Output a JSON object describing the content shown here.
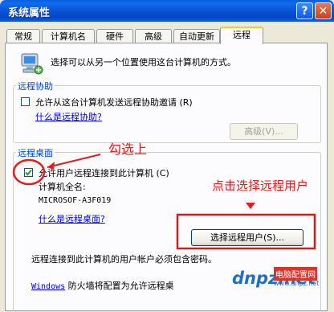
{
  "window": {
    "title": "系统属性"
  },
  "title_buttons": {
    "help": "?",
    "close": "✕"
  },
  "tabs": [
    "常规",
    "计算机名",
    "硬件",
    "高级",
    "自动更新",
    "远程"
  ],
  "intro": {
    "text": "选择可以从另一个位置使用这台计算机的方式。"
  },
  "remote_assistance": {
    "title": "远程协助",
    "checkbox_label": "允许从这台计算机发送远程协助邀请",
    "checkbox_hotkey": "(R)",
    "checked": false,
    "link": "什么是远程协助?",
    "advanced_button": "高级(V)..."
  },
  "remote_desktop": {
    "title": "远程桌面",
    "checkbox_label": "允许用户远程连接到此计算机",
    "checkbox_hotkey": "(C)",
    "checked": true,
    "computer_name_label": "计算机全名:",
    "computer_name": "MICROSOF-A3F019",
    "link": "什么是远程桌面?",
    "select_users_button": "选择远程用户(S)...",
    "note": "远程连接到此计算机的用户帐户必须包含密码。",
    "firewall_prefix": "Windows",
    "firewall_text": "防火墙将配置为允许远程桌"
  },
  "annotations": {
    "check_hint": "勾选上",
    "click_hint": "点击选择远程用户"
  },
  "watermark": {
    "brand": "dnpz.net",
    "site": "电脑配置网",
    "url": "www.dnpz.net"
  },
  "colors": {
    "titlebar": "#0a5fd8",
    "annotation": "#e02020",
    "link": "#0000ff",
    "group_title": "#0046d5"
  }
}
